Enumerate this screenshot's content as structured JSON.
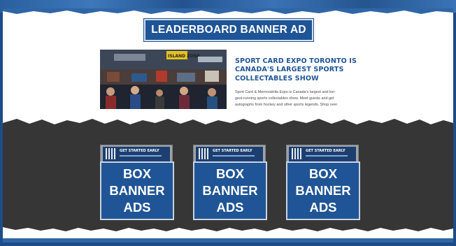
{
  "leaderboard": {
    "label": "LEADERBOARD BANNER AD"
  },
  "article": {
    "photo_sign": "ISLAND ZONE",
    "headline_lines": [
      "SPORT CARD EXPO TORONTO IS",
      "CANADA'S LARGEST SPORTS",
      "COLLECTABLES SHOW"
    ],
    "body_lines": [
      "Sport Card & Memorabilia Expo is Canada's largest and lon-",
      "gest-running sports collectables show. Meet guests and get",
      "autographs from hockey and other sports legends. Shop over"
    ]
  },
  "box_ads": [
    {
      "label_lines": [
        "BOX",
        "BANNER",
        "ADS"
      ],
      "thumb_title": "GET STARTED EARLY"
    },
    {
      "label_lines": [
        "BOX",
        "BANNER",
        "ADS"
      ],
      "thumb_title": "GET STARTED EARLY"
    },
    {
      "label_lines": [
        "BOX",
        "BANNER",
        "ADS"
      ],
      "thumb_title": "GET STARTED EARLY"
    }
  ],
  "colors": {
    "brand_blue": "#1f5596",
    "frame_blue": "#1d4c86",
    "dark_section": "#363636",
    "text_gray": "#4a4a4a"
  }
}
